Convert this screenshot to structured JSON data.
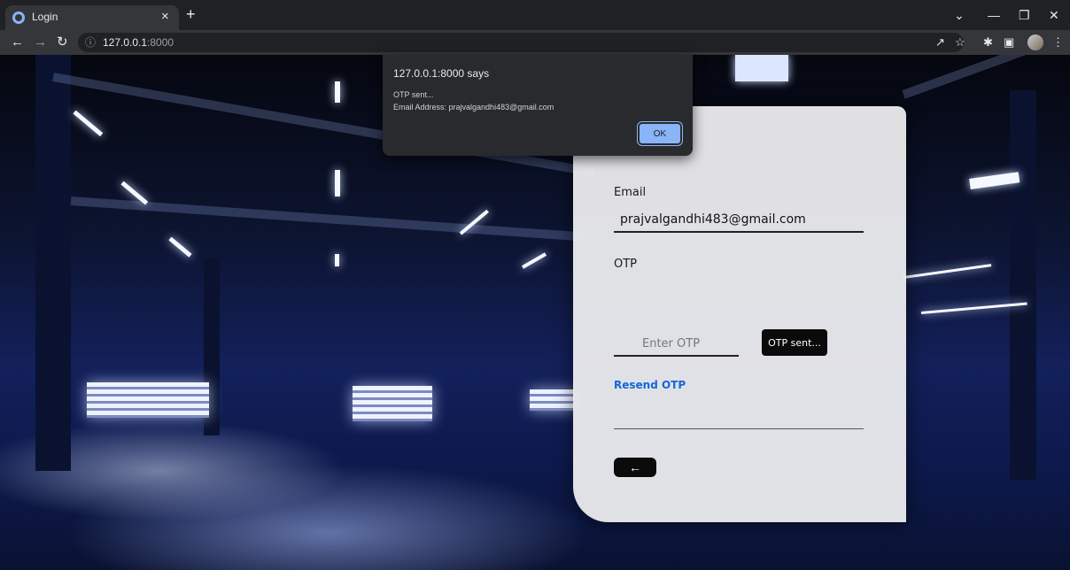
{
  "browser": {
    "tab_title": "Login",
    "tab_close": "×",
    "new_tab": "+",
    "url_host": "127.0.0.1",
    "url_port": ":8000",
    "icons": [
      "back-arrow-icon",
      "forward-arrow-icon",
      "reload-icon",
      "info-icon",
      "share-icon",
      "star-icon",
      "extensions-icon",
      "sidepanel-icon",
      "profile-avatar",
      "menu-icon"
    ]
  },
  "dialog": {
    "title": "127.0.0.1:8000 says",
    "message_line1": "OTP sent...",
    "message_line2": "Email Address: prajvalgandhi483@gmail.com",
    "ok_label": "OK"
  },
  "form": {
    "email_label": "Email",
    "email_value": "prajvalgandhi483@gmail.com",
    "otp_label": "OTP",
    "otp_placeholder": "Enter OTP",
    "otp_button_label": "OTP sent...",
    "resend_label": "Resend OTP",
    "back_icon": "←"
  },
  "colors": {
    "accent_link": "#1565d8",
    "dialog_button": "#8ab4f8",
    "dialog_bg": "#292a2d"
  }
}
